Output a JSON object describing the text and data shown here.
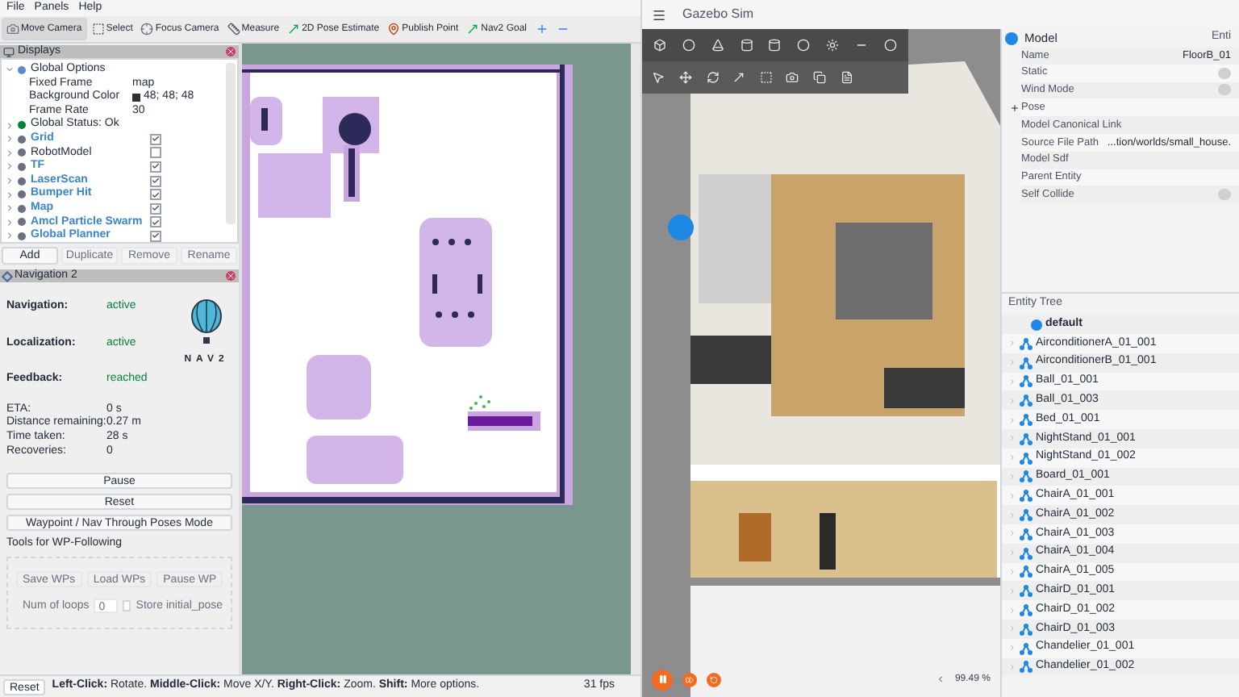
{
  "rviz": {
    "menu": [
      "File",
      "Panels",
      "Help"
    ],
    "toolbar": [
      {
        "label": "Move Camera",
        "kind": "camera",
        "selected": true
      },
      {
        "label": "Select",
        "kind": "select",
        "selected": false
      },
      {
        "label": "Focus Camera",
        "kind": "focus",
        "selected": false
      },
      {
        "label": "Measure",
        "kind": "measure",
        "selected": false
      },
      {
        "label": "2D Pose Estimate",
        "kind": "pose",
        "selected": false
      },
      {
        "label": "Publish Point",
        "kind": "point",
        "selected": false
      },
      {
        "label": "Nav2 Goal",
        "kind": "goal",
        "selected": false
      },
      {
        "kind": "plus",
        "selected": false
      },
      {
        "kind": "minus",
        "selected": false
      }
    ],
    "displays": {
      "title": "Displays",
      "tree": [
        {
          "name": "Global Options",
          "kind": "options",
          "expanded": true,
          "children": [
            {
              "name": "Fixed Frame",
              "value": "map"
            },
            {
              "name": "Background Color",
              "value": "48; 48; 48",
              "color": "#303030"
            },
            {
              "name": "Frame Rate",
              "value": "30"
            }
          ]
        },
        {
          "name": "Global Status: Ok",
          "kind": "status",
          "expanded": false
        },
        {
          "name": "Grid",
          "kind": "display",
          "expanded": false,
          "checked": true
        },
        {
          "name": "RobotModel",
          "kind": "display",
          "expanded": false,
          "checked": false
        },
        {
          "name": "TF",
          "kind": "display",
          "expanded": false,
          "checked": true
        },
        {
          "name": "LaserScan",
          "kind": "display",
          "expanded": false,
          "checked": true
        },
        {
          "name": "Bumper Hit",
          "kind": "display",
          "expanded": false,
          "checked": true
        },
        {
          "name": "Map",
          "kind": "display",
          "expanded": false,
          "checked": true
        },
        {
          "name": "Amcl Particle Swarm",
          "kind": "display",
          "expanded": false,
          "checked": true
        },
        {
          "name": "Global Planner",
          "kind": "display",
          "expanded": false,
          "checked": true
        }
      ],
      "buttons": [
        {
          "label": "Add",
          "disabled": false
        },
        {
          "label": "Duplicate",
          "disabled": true
        },
        {
          "label": "Remove",
          "disabled": true
        },
        {
          "label": "Rename",
          "disabled": true
        }
      ]
    },
    "nav": {
      "title": "Navigation 2",
      "logo_text": "NAV2",
      "status": [
        {
          "label": "Navigation:",
          "value": "active"
        },
        {
          "label": "Localization:",
          "value": "active"
        },
        {
          "label": "Feedback:",
          "value": "reached"
        }
      ],
      "stats": [
        {
          "label": "ETA:",
          "value": "0 s"
        },
        {
          "label": "Distance remaining:",
          "value": "0.27 m"
        },
        {
          "label": "Time taken:",
          "value": "28 s"
        },
        {
          "label": "Recoveries:",
          "value": "0"
        }
      ],
      "buttons": [
        "Pause",
        "Reset",
        "Waypoint / Nav Through Poses Mode"
      ],
      "wp_group": {
        "title": "Tools for WP-Following",
        "buttons": [
          {
            "label": "Save WPs",
            "disabled": true
          },
          {
            "label": "Load WPs",
            "disabled": true
          },
          {
            "label": "Pause WP",
            "disabled": true
          }
        ],
        "loops_label": "Num of loops",
        "loops_value": "0",
        "store_label": "Store initial_pose",
        "store_checked": false,
        "disabled": true
      }
    },
    "status_bar": {
      "reset": "Reset",
      "hint": "**Left-Click:** Rotate. **Middle-Click:** Move X/Y. **Right-Click:** Zoom. **Shift:** More options.",
      "fps": "31 fps"
    }
  },
  "gazebo": {
    "title": "Gazebo Sim",
    "rtf": "99.49 %",
    "inspector": {
      "title": "Model",
      "tab": "Enti",
      "properties": [
        {
          "name": "Name",
          "kind": "text",
          "value": "FloorB_01"
        },
        {
          "name": "Static",
          "kind": "toggle",
          "on": false
        },
        {
          "name": "Wind Mode",
          "kind": "toggle",
          "on": false
        },
        {
          "name": "Pose",
          "kind": "group",
          "expanded": false
        },
        {
          "name": "Model Canonical Link",
          "kind": "text"
        },
        {
          "name": "Source File Path",
          "kind": "text",
          "value": "...tion/worlds/small_house."
        },
        {
          "name": "Model Sdf",
          "kind": "text"
        },
        {
          "name": "Parent Entity",
          "kind": "text"
        },
        {
          "name": "Self Collide",
          "kind": "toggle",
          "on": false
        }
      ]
    },
    "entity_tree": {
      "title": "Entity Tree",
      "items": [
        {
          "name": "default",
          "kind": "world"
        },
        {
          "name": "AirconditionerA_01_001",
          "kind": "model"
        },
        {
          "name": "AirconditionerB_01_001",
          "kind": "model"
        },
        {
          "name": "Ball_01_001",
          "kind": "model"
        },
        {
          "name": "Ball_01_003",
          "kind": "model"
        },
        {
          "name": "Bed_01_001",
          "kind": "model"
        },
        {
          "name": "NightStand_01_001",
          "kind": "model"
        },
        {
          "name": "NightStand_01_002",
          "kind": "model"
        },
        {
          "name": "Board_01_001",
          "kind": "model"
        },
        {
          "name": "ChairA_01_001",
          "kind": "model"
        },
        {
          "name": "ChairA_01_002",
          "kind": "model"
        },
        {
          "name": "ChairA_01_003",
          "kind": "model"
        },
        {
          "name": "ChairA_01_004",
          "kind": "model"
        },
        {
          "name": "ChairA_01_005",
          "kind": "model"
        },
        {
          "name": "ChairD_01_001",
          "kind": "model"
        },
        {
          "name": "ChairD_01_002",
          "kind": "model"
        },
        {
          "name": "ChairD_01_003",
          "kind": "model"
        },
        {
          "name": "Chandelier_01_001",
          "kind": "model"
        },
        {
          "name": "Chandelier_01_002",
          "kind": "model"
        }
      ]
    }
  }
}
